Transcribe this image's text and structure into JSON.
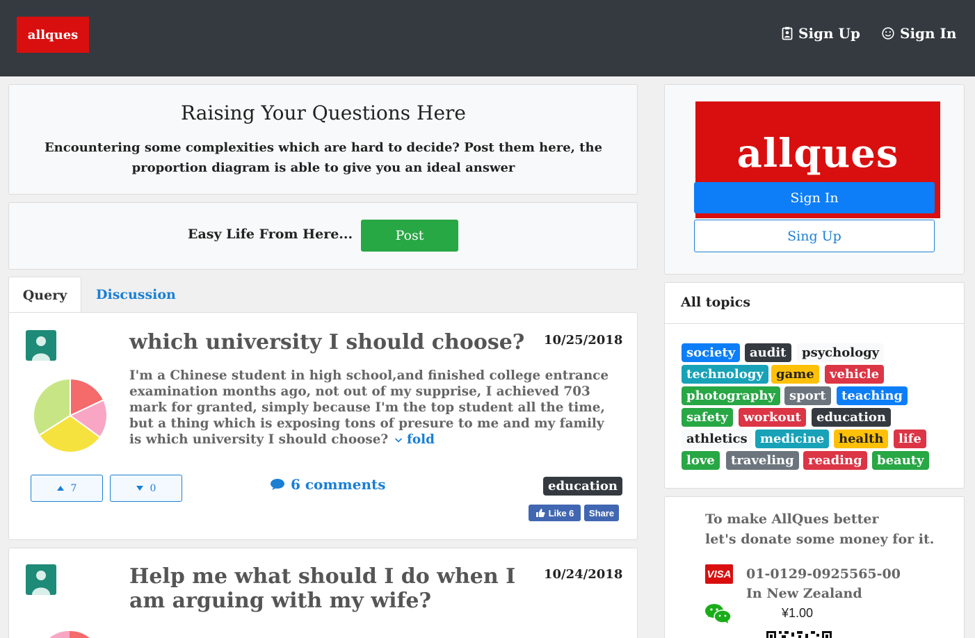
{
  "brand": {
    "logo_text": "allques"
  },
  "nav": {
    "signup_label": "Sign Up",
    "signin_label": "Sign In"
  },
  "hero": {
    "title": "Raising Your Questions Here",
    "subtitle": "Encountering some complexities which are hard to decide? Post them here, the proportion diagram is able to give you an ideal answer"
  },
  "post_bar": {
    "label": "Easy Life From Here...",
    "button": "Post"
  },
  "tabs": [
    {
      "label": "Query",
      "active": true
    },
    {
      "label": "Discussion",
      "active": false
    }
  ],
  "questions": [
    {
      "title": "which university I should choose?",
      "date": "10/25/2018",
      "body": "I'm a Chinese student in high school,and finished college entrance examination months ago, not out of my supprise, I achieved 703 mark for granted, simply because I'm the top student all the time, but a thing which is exposing tons of presure to me and my family is which university I should choose?",
      "fold_label": "fold",
      "upvotes": "7",
      "downvotes": "0",
      "comments": "6 comments",
      "tag": "education",
      "like_label": "Like 6",
      "share_label": "Share",
      "pie": [
        {
          "value": 0.18,
          "color": "#f56a6a"
        },
        {
          "value": 0.17,
          "color": "#f8a6c4"
        },
        {
          "value": 0.31,
          "color": "#f6e23e"
        },
        {
          "value": 0.34,
          "color": "#c8e586"
        }
      ]
    },
    {
      "title_line1": "Help me what should I do when I",
      "title_line2": "am arguing with my wife?",
      "date": "10/24/2018"
    }
  ],
  "sidebar": {
    "logo_text": "allques",
    "signin": "Sign In",
    "signup": "Sing Up",
    "topics_title": "All topics",
    "topics": [
      {
        "label": "society",
        "color": "#0d7ef7"
      },
      {
        "label": "audit",
        "color": "#343a40"
      },
      {
        "label": "psychology",
        "color": "#f8f9fa",
        "text": "#222"
      },
      {
        "label": "technology",
        "color": "#17a2b8"
      },
      {
        "label": "game",
        "color": "#ffc107",
        "text": "#222"
      },
      {
        "label": "vehicle",
        "color": "#dc3545"
      },
      {
        "label": "photography",
        "color": "#28a745"
      },
      {
        "label": "sport",
        "color": "#6c757d"
      },
      {
        "label": "teaching",
        "color": "#0d7ef7"
      },
      {
        "label": "safety",
        "color": "#28a745"
      },
      {
        "label": "workout",
        "color": "#dc3545"
      },
      {
        "label": "education",
        "color": "#343a40"
      },
      {
        "label": "athletics",
        "color": "#f8f9fa",
        "text": "#222"
      },
      {
        "label": "medicine",
        "color": "#17a2b8"
      },
      {
        "label": "health",
        "color": "#ffc107",
        "text": "#222"
      },
      {
        "label": "life",
        "color": "#dc3545"
      },
      {
        "label": "love",
        "color": "#28a745"
      },
      {
        "label": "traveling",
        "color": "#6c757d"
      },
      {
        "label": "reading",
        "color": "#dc3545"
      },
      {
        "label": "beauty",
        "color": "#28a745"
      }
    ],
    "donate": {
      "line1": "To make AllQues better",
      "line2": "let's donate some money for it.",
      "visa_label": "VISA",
      "account": "01-0129-0925565-00",
      "country": "In New Zealand",
      "amount": "¥1.00"
    }
  }
}
